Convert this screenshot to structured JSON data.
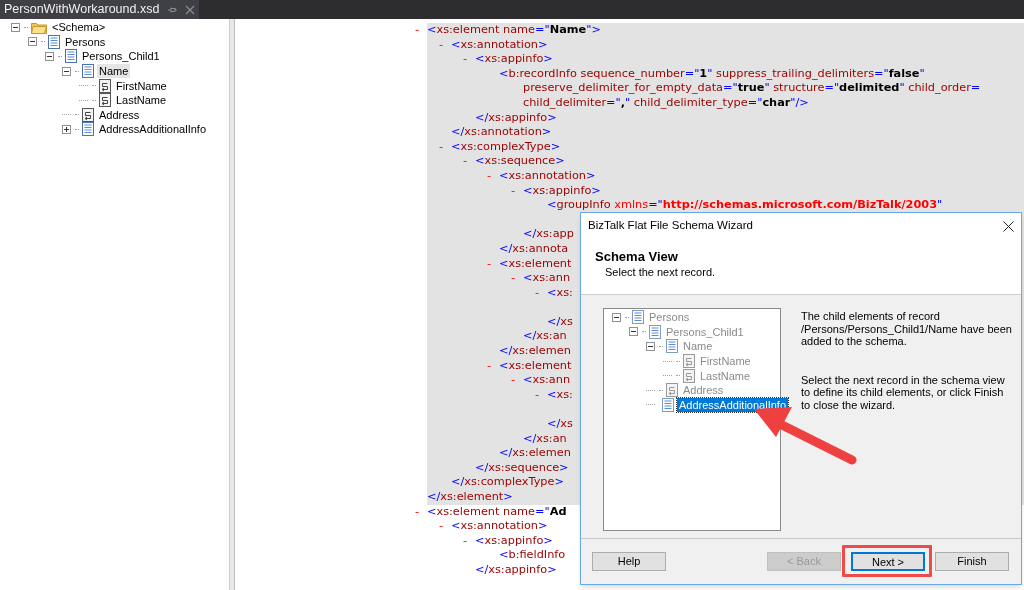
{
  "tab": {
    "title": "PersonWithWorkaround.xsd"
  },
  "schema_tree": [
    {
      "label": "<Schema>",
      "kind": "folder",
      "expanded": true,
      "selected": false,
      "children": [
        {
          "label": "Persons",
          "kind": "record",
          "expanded": true,
          "selected": false,
          "children": [
            {
              "label": "Persons_Child1",
              "kind": "record",
              "expanded": true,
              "selected": false,
              "children": [
                {
                  "label": "Name",
                  "kind": "record",
                  "expanded": true,
                  "selected": true,
                  "children": [
                    {
                      "label": "FirstName",
                      "kind": "field",
                      "selected": false
                    },
                    {
                      "label": "LastName",
                      "kind": "field",
                      "selected": false
                    }
                  ]
                },
                {
                  "label": "Address",
                  "kind": "field",
                  "selected": false
                },
                {
                  "label": "AddressAdditionalInfo",
                  "kind": "record",
                  "expanded": false,
                  "selected": false
                }
              ]
            }
          ]
        }
      ]
    }
  ],
  "xml": [
    {
      "toggle": "-",
      "selected": true,
      "open": [
        {
          "kind": "punct",
          "text": "<"
        },
        {
          "kind": "name",
          "text": "xs:element name"
        },
        {
          "kind": "punct",
          "text": "=\""
        },
        {
          "kind": "value",
          "text": "Name"
        },
        {
          "kind": "punct",
          "text": "\">"
        }
      ],
      "children": [
        {
          "toggle": "-",
          "open": [
            {
              "kind": "punct",
              "text": "<"
            },
            {
              "kind": "name",
              "text": "xs:annotation"
            },
            {
              "kind": "punct",
              "text": ">"
            }
          ],
          "children": [
            {
              "toggle": "-",
              "open": [
                {
                  "kind": "punct",
                  "text": "<"
                },
                {
                  "kind": "name",
                  "text": "xs:appinfo"
                },
                {
                  "kind": "punct",
                  "text": ">"
                }
              ],
              "children": [
                {
                  "open": [
                    {
                      "kind": "punct",
                      "text": "<"
                    },
                    {
                      "kind": "name",
                      "text": "b:recordInfo sequence_number"
                    },
                    {
                      "kind": "punct",
                      "text": "=\""
                    },
                    {
                      "kind": "value",
                      "text": "1"
                    },
                    {
                      "kind": "punct",
                      "text": "\""
                    },
                    {
                      "kind": "name",
                      "text": " suppress_trailing_delimiters"
                    },
                    {
                      "kind": "punct",
                      "text": "=\""
                    },
                    {
                      "kind": "value",
                      "text": "false"
                    },
                    {
                      "kind": "punct",
                      "text": "\""
                    }
                  ],
                  "more": [
                    {
                      "tokens": [
                        {
                          "kind": "name",
                          "text": "preserve_delimiter_for_empty_data"
                        },
                        {
                          "kind": "punct",
                          "text": "=\""
                        },
                        {
                          "kind": "value",
                          "text": "true"
                        },
                        {
                          "kind": "punct",
                          "text": "\""
                        },
                        {
                          "kind": "name",
                          "text": " structure"
                        },
                        {
                          "kind": "punct",
                          "text": "=\""
                        },
                        {
                          "kind": "value",
                          "text": "delimited"
                        },
                        {
                          "kind": "punct",
                          "text": "\""
                        },
                        {
                          "kind": "name",
                          "text": " child_order"
                        },
                        {
                          "kind": "punct",
                          "text": "="
                        }
                      ]
                    },
                    {
                      "tokens": [
                        {
                          "kind": "name",
                          "text": "child_delimiter"
                        },
                        {
                          "kind": "punct",
                          "text": "=\""
                        },
                        {
                          "kind": "value",
                          "text": ","
                        },
                        {
                          "kind": "punct",
                          "text": "\""
                        },
                        {
                          "kind": "name",
                          "text": " child_delimiter_type"
                        },
                        {
                          "kind": "punct",
                          "text": "=\""
                        },
                        {
                          "kind": "value",
                          "text": "char"
                        },
                        {
                          "kind": "punct",
                          "text": "\"/>"
                        }
                      ]
                    }
                  ]
                }
              ],
              "close": [
                {
                  "kind": "punct",
                  "text": "</"
                },
                {
                  "kind": "name",
                  "text": "xs:appinfo"
                },
                {
                  "kind": "punct",
                  "text": ">"
                }
              ]
            }
          ],
          "close": [
            {
              "kind": "punct",
              "text": "</"
            },
            {
              "kind": "name",
              "text": "xs:annotation"
            },
            {
              "kind": "punct",
              "text": ">"
            }
          ]
        },
        {
          "toggle": "-",
          "open": [
            {
              "kind": "punct",
              "text": "<"
            },
            {
              "kind": "name",
              "text": "xs:complexType"
            },
            {
              "kind": "punct",
              "text": ">"
            }
          ],
          "children": [
            {
              "toggle": "-",
              "open": [
                {
                  "kind": "punct",
                  "text": "<"
                },
                {
                  "kind": "name",
                  "text": "xs:sequence"
                },
                {
                  "kind": "punct",
                  "text": ">"
                }
              ],
              "children": [
                {
                  "toggle": "-",
                  "open": [
                    {
                      "kind": "punct",
                      "text": "<"
                    },
                    {
                      "kind": "name",
                      "text": "xs:annotation"
                    },
                    {
                      "kind": "punct",
                      "text": ">"
                    }
                  ],
                  "children": [
                    {
                      "toggle": "-",
                      "open": [
                        {
                          "kind": "punct",
                          "text": "<"
                        },
                        {
                          "kind": "name",
                          "text": "xs:appinfo"
                        },
                        {
                          "kind": "punct",
                          "text": ">"
                        }
                      ],
                      "children": [
                        {
                          "open": [
                            {
                              "kind": "punct",
                              "text": "<"
                            },
                            {
                              "kind": "name",
                              "text": "groupInfo"
                            },
                            {
                              "kind": "ns",
                              "text": " xmlns"
                            },
                            {
                              "kind": "punct",
                              "text": "=\""
                            },
                            {
                              "kind": "url",
                              "text": "http://schemas.microsoft.com/BizTalk/2003"
                            },
                            {
                              "kind": "punct",
                              "text": "\""
                            }
                          ],
                          "more": [
                            {
                              "covered": true
                            }
                          ]
                        }
                      ],
                      "close": [
                        {
                          "kind": "punct",
                          "text": "</"
                        },
                        {
                          "kind": "name",
                          "text": "xs:app"
                        }
                      ]
                    }
                  ],
                  "close": [
                    {
                      "kind": "punct",
                      "text": "</"
                    },
                    {
                      "kind": "name",
                      "text": "xs:annota"
                    }
                  ]
                },
                {
                  "toggle": "-",
                  "open": [
                    {
                      "kind": "punct",
                      "text": "<"
                    },
                    {
                      "kind": "name",
                      "text": "xs:element"
                    }
                  ],
                  "children": [
                    {
                      "toggle": "-",
                      "open": [
                        {
                          "kind": "punct",
                          "text": "<"
                        },
                        {
                          "kind": "name",
                          "text": "xs:ann"
                        }
                      ],
                      "children": [
                        {
                          "toggle": "-",
                          "open": [
                            {
                              "kind": "punct",
                              "text": "<"
                            },
                            {
                              "kind": "name",
                              "text": "xs:"
                            }
                          ],
                          "children": [
                            {
                              "covered": true
                            }
                          ],
                          "close": [
                            {
                              "kind": "punct",
                              "text": "</"
                            },
                            {
                              "kind": "name",
                              "text": "xs"
                            }
                          ]
                        }
                      ],
                      "close": [
                        {
                          "kind": "punct",
                          "text": "</"
                        },
                        {
                          "kind": "name",
                          "text": "xs:an"
                        }
                      ]
                    }
                  ],
                  "close": [
                    {
                      "kind": "punct",
                      "text": "</"
                    },
                    {
                      "kind": "name",
                      "text": "xs:elemen"
                    }
                  ]
                },
                {
                  "toggle": "-",
                  "open": [
                    {
                      "kind": "punct",
                      "text": "<"
                    },
                    {
                      "kind": "name",
                      "text": "xs:element"
                    }
                  ],
                  "children": [
                    {
                      "toggle": "-",
                      "open": [
                        {
                          "kind": "punct",
                          "text": "<"
                        },
                        {
                          "kind": "name",
                          "text": "xs:ann"
                        }
                      ],
                      "children": [
                        {
                          "toggle": "-",
                          "open": [
                            {
                              "kind": "punct",
                              "text": "<"
                            },
                            {
                              "kind": "name",
                              "text": "xs:"
                            }
                          ],
                          "children": [
                            {
                              "covered": true
                            }
                          ],
                          "close": [
                            {
                              "kind": "punct",
                              "text": "</"
                            },
                            {
                              "kind": "name",
                              "text": "xs"
                            }
                          ]
                        }
                      ],
                      "close": [
                        {
                          "kind": "punct",
                          "text": "</"
                        },
                        {
                          "kind": "name",
                          "text": "xs:an"
                        }
                      ]
                    }
                  ],
                  "close": [
                    {
                      "kind": "punct",
                      "text": "</"
                    },
                    {
                      "kind": "name",
                      "text": "xs:elemen"
                    }
                  ]
                }
              ],
              "close": [
                {
                  "kind": "punct",
                  "text": "</"
                },
                {
                  "kind": "name",
                  "text": "xs:sequence"
                },
                {
                  "kind": "punct",
                  "text": ">"
                }
              ]
            }
          ],
          "close": [
            {
              "kind": "punct",
              "text": "</"
            },
            {
              "kind": "name",
              "text": "xs:complexType"
            },
            {
              "kind": "punct",
              "text": ">"
            }
          ]
        }
      ],
      "close": [
        {
          "kind": "punct",
          "text": "</"
        },
        {
          "kind": "name",
          "text": "xs:element"
        },
        {
          "kind": "punct",
          "text": ">"
        }
      ]
    },
    {
      "toggle": "-",
      "selected": false,
      "open": [
        {
          "kind": "punct",
          "text": "<"
        },
        {
          "kind": "name",
          "text": "xs:element name"
        },
        {
          "kind": "punct",
          "text": "=\""
        },
        {
          "kind": "value",
          "text": "Ad"
        }
      ],
      "children": [
        {
          "toggle": "-",
          "open": [
            {
              "kind": "punct",
              "text": "<"
            },
            {
              "kind": "name",
              "text": "xs:annotation"
            },
            {
              "kind": "punct",
              "text": ">"
            }
          ],
          "children": [
            {
              "toggle": "-",
              "open": [
                {
                  "kind": "punct",
                  "text": "<"
                },
                {
                  "kind": "name",
                  "text": "xs:appinfo"
                },
                {
                  "kind": "punct",
                  "text": ">"
                }
              ],
              "children": [
                {
                  "open": [
                    {
                      "kind": "punct",
                      "text": "<"
                    },
                    {
                      "kind": "name",
                      "text": "b:fieldInfo"
                    }
                  ]
                }
              ],
              "close": [
                {
                  "kind": "punct",
                  "text": "</"
                },
                {
                  "kind": "name",
                  "text": "xs:appinfo"
                },
                {
                  "kind": "punct",
                  "text": ">"
                }
              ]
            }
          ]
        }
      ]
    }
  ],
  "dialog": {
    "title": "BizTalk Flat File Schema Wizard",
    "heading": "Schema View",
    "subtitle": "Select the next record.",
    "tree": [
      {
        "label": "Persons",
        "kind": "record",
        "expanded": true,
        "selected": false,
        "children": [
          {
            "label": "Persons_Child1",
            "kind": "record",
            "expanded": true,
            "selected": false,
            "children": [
              {
                "label": "Name",
                "kind": "record",
                "expanded": true,
                "selected": false,
                "children": [
                  {
                    "label": "FirstName",
                    "kind": "field",
                    "selected": false
                  },
                  {
                    "label": "LastName",
                    "kind": "field",
                    "selected": false
                  }
                ]
              },
              {
                "label": "Address",
                "kind": "field",
                "selected": false
              },
              {
                "label": "AddressAdditionalInfo",
                "kind": "record",
                "selected": true
              }
            ]
          }
        ]
      }
    ],
    "messages": [
      "The child elements of record /Persons/Persons_Child1/Name have been added to the schema.",
      "Select the next record in the schema view to define its child elements, or click Finish to close the wizard."
    ],
    "buttons": [
      {
        "label": "Help",
        "disabled": false,
        "focused": false,
        "highlighted": false
      },
      {
        "label": "< Back",
        "disabled": true,
        "focused": false,
        "highlighted": false
      },
      {
        "label": "Next >",
        "disabled": false,
        "focused": true,
        "highlighted": true
      },
      {
        "label": "Finish",
        "disabled": false,
        "focused": false,
        "highlighted": false
      }
    ]
  }
}
